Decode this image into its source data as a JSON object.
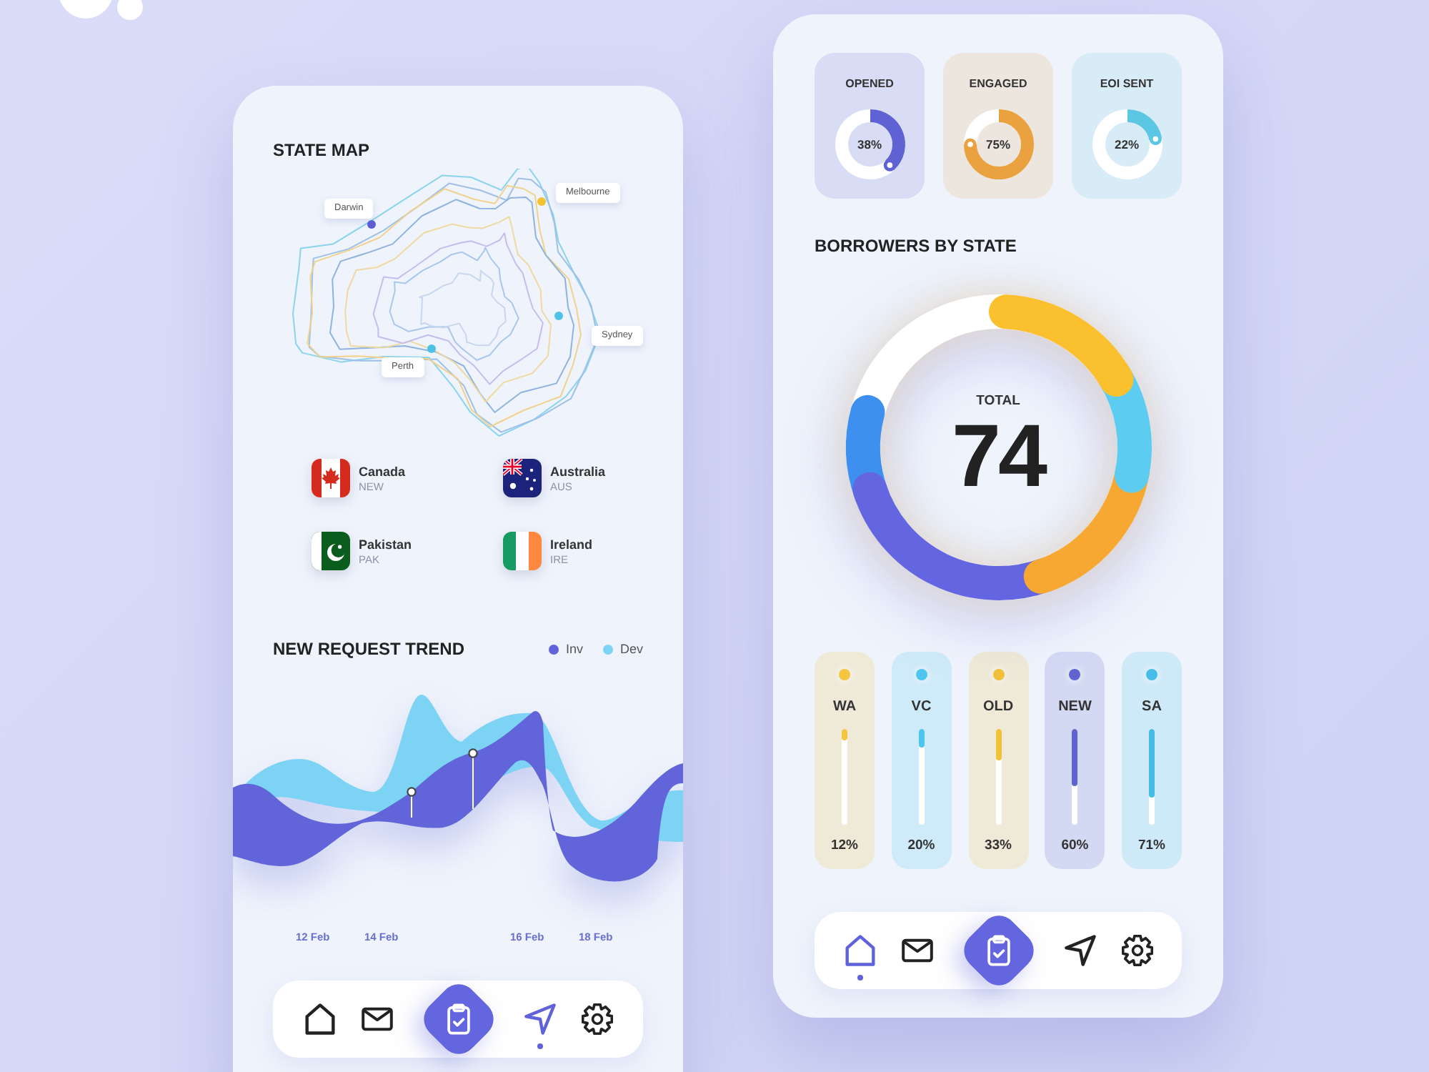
{
  "state_map": {
    "title": "STATE MAP",
    "cities": [
      {
        "name": "Darwin",
        "color": "#5b5fd0"
      },
      {
        "name": "Melbourne",
        "color": "#f2c233"
      },
      {
        "name": "Sydney",
        "color": "#4cc3e6"
      },
      {
        "name": "Perth",
        "color": "#4cc3e6"
      }
    ],
    "countries": [
      {
        "name": "Canada",
        "code": "NEW",
        "kind": "canada"
      },
      {
        "name": "Australia",
        "code": "AUS",
        "kind": "australia"
      },
      {
        "name": "Pakistan",
        "code": "PAK",
        "kind": "pakistan"
      },
      {
        "name": "Ireland",
        "code": "IRE",
        "kind": "ireland"
      }
    ]
  },
  "request_trend": {
    "title": "NEW REQUEST TREND",
    "legend": [
      {
        "label": "Inv",
        "color": "#6265da"
      },
      {
        "label": "Dev",
        "color": "#7dd3f3"
      }
    ],
    "dates": [
      "12 Feb",
      "14 Feb",
      "16 Feb",
      "18 Feb"
    ]
  },
  "left_nav": [
    {
      "kind": "home",
      "selected": false
    },
    {
      "kind": "mail",
      "selected": false
    },
    {
      "kind": "clipboard",
      "selected": false
    },
    {
      "kind": "send",
      "selected": true
    },
    {
      "kind": "settings",
      "selected": false
    }
  ],
  "stats": [
    {
      "title": "OPENED",
      "value": "38%",
      "color": "#5f62d2"
    },
    {
      "title": "ENGAGED",
      "value": "75%",
      "color": "#e9a23f"
    },
    {
      "title": "EOI SENT",
      "value": "22%",
      "color": "#5cc7e3"
    }
  ],
  "borrowers": {
    "title": "BORROWERS BY STATE",
    "total_label": "TOTAL",
    "total": "74"
  },
  "states": [
    {
      "name": "WA",
      "value": "12%",
      "level": 0.12,
      "color": "#f4c640"
    },
    {
      "name": "VC",
      "value": "20%",
      "level": 0.2,
      "color": "#4cc6ec"
    },
    {
      "name": "OLD",
      "value": "33%",
      "level": 0.33,
      "color": "#f2c13a"
    },
    {
      "name": "NEW",
      "value": "60%",
      "level": 0.6,
      "color": "#6164cf"
    },
    {
      "name": "SA",
      "value": "71%",
      "level": 0.71,
      "color": "#45bde6"
    }
  ],
  "right_nav": [
    {
      "kind": "home",
      "selected": true
    },
    {
      "kind": "mail",
      "selected": false
    },
    {
      "kind": "clipboard",
      "selected": false
    },
    {
      "kind": "send",
      "selected": false
    },
    {
      "kind": "settings",
      "selected": false
    }
  ]
}
